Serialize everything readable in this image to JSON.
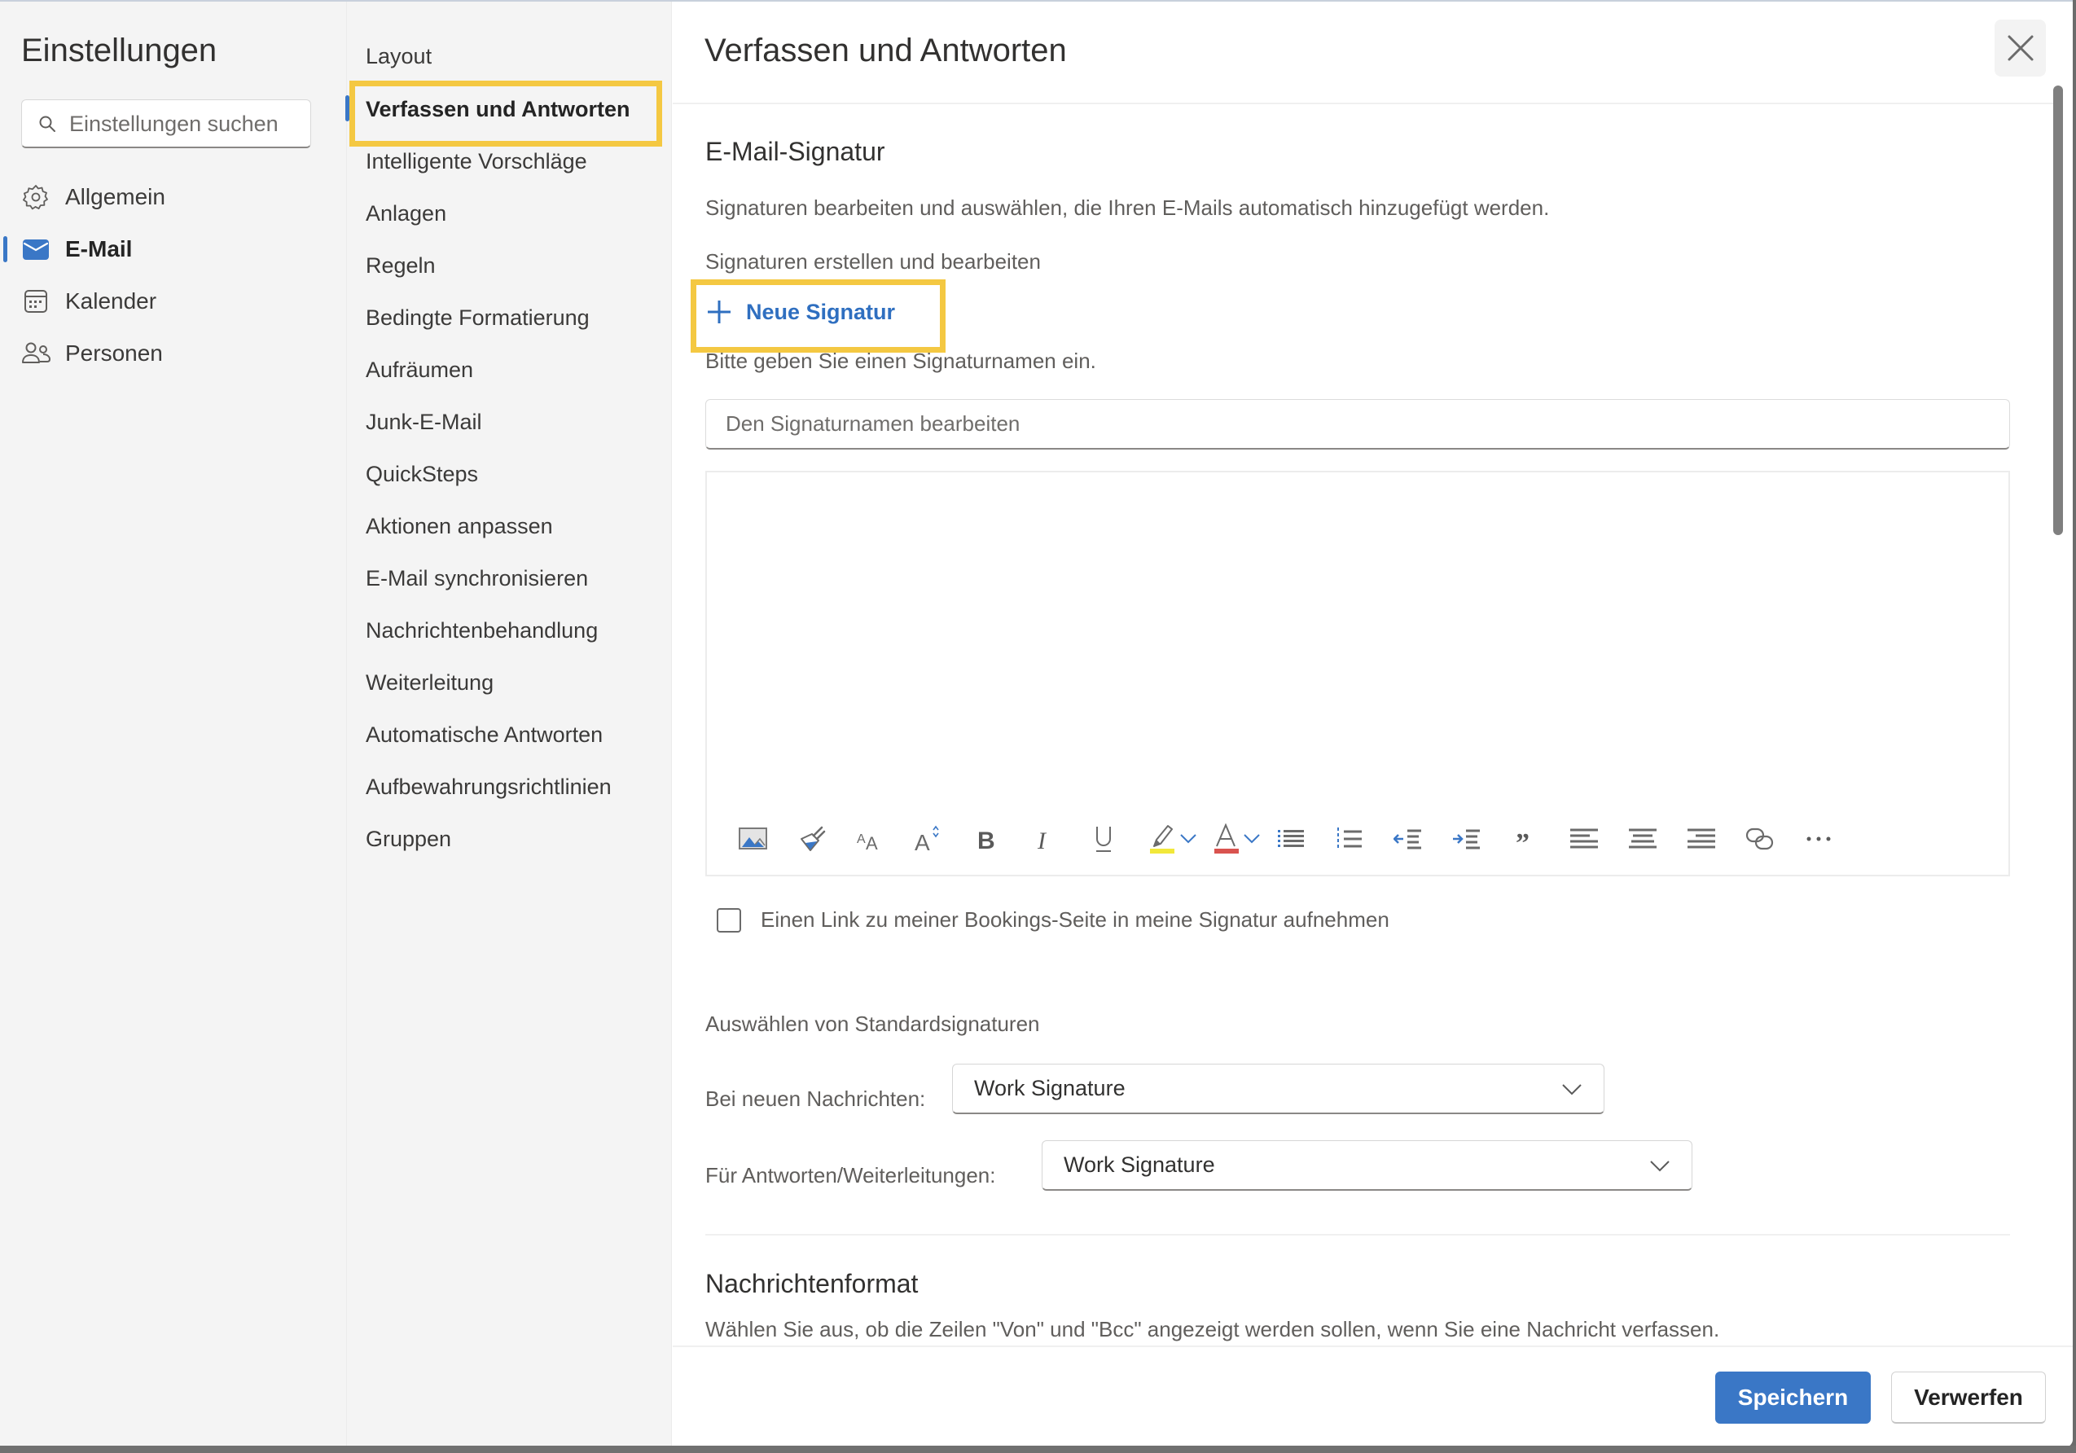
{
  "app": {
    "title": "Einstellungen",
    "search_placeholder": "Einstellungen suchen"
  },
  "nav": {
    "items": [
      {
        "label": "Allgemein",
        "icon": "gear-icon",
        "active": false
      },
      {
        "label": "E-Mail",
        "icon": "mail-icon",
        "active": true
      },
      {
        "label": "Kalender",
        "icon": "calendar-icon",
        "active": false
      },
      {
        "label": "Personen",
        "icon": "people-icon",
        "active": false
      }
    ]
  },
  "subnav": {
    "items": [
      {
        "label": "Layout",
        "active": false
      },
      {
        "label": "Verfassen und Antworten",
        "active": true
      },
      {
        "label": "Intelligente Vorschläge",
        "active": false
      },
      {
        "label": "Anlagen",
        "active": false
      },
      {
        "label": "Regeln",
        "active": false
      },
      {
        "label": "Bedingte Formatierung",
        "active": false
      },
      {
        "label": "Aufräumen",
        "active": false
      },
      {
        "label": "Junk-E-Mail",
        "active": false
      },
      {
        "label": "QuickSteps",
        "active": false
      },
      {
        "label": "Aktionen anpassen",
        "active": false
      },
      {
        "label": "E-Mail synchronisieren",
        "active": false
      },
      {
        "label": "Nachrichtenbehandlung",
        "active": false
      },
      {
        "label": "Weiterleitung",
        "active": false
      },
      {
        "label": "Automatische Antworten",
        "active": false
      },
      {
        "label": "Aufbewahrungsrichtlinien",
        "active": false
      },
      {
        "label": "Gruppen",
        "active": false
      }
    ]
  },
  "main": {
    "title": "Verfassen und Antworten",
    "close_icon": "close-icon",
    "signature": {
      "heading": "E-Mail-Signatur",
      "description": "Signaturen bearbeiten und auswählen, die Ihren E-Mails automatisch hinzugefügt werden.",
      "create_label": "Signaturen erstellen und bearbeiten",
      "new_signature_label": "Neue Signatur",
      "name_prompt": "Bitte geben Sie einen Signaturnamen ein.",
      "name_input_value": "",
      "name_input_placeholder": "Den Signaturnamen bearbeiten",
      "editor_content": "",
      "toolbar": [
        {
          "name": "insert-image",
          "icon": "image-icon"
        },
        {
          "name": "format-painter",
          "icon": "paintbrush-icon"
        },
        {
          "name": "font-size",
          "icon": "font-size-icon"
        },
        {
          "name": "text-effects",
          "icon": "text-effects-icon"
        },
        {
          "name": "bold",
          "icon": "bold-icon"
        },
        {
          "name": "italic",
          "icon": "italic-icon"
        },
        {
          "name": "underline",
          "icon": "underline-icon"
        },
        {
          "name": "highlight",
          "icon": "highlighter-icon",
          "color": "#f2e83a"
        },
        {
          "name": "highlight-dropdown",
          "icon": "chevron-down-icon"
        },
        {
          "name": "font-color",
          "icon": "font-color-icon",
          "color": "#d9534f"
        },
        {
          "name": "font-color-dropdown",
          "icon": "chevron-down-icon"
        },
        {
          "name": "bullets",
          "icon": "bulleted-list-icon"
        },
        {
          "name": "numbering",
          "icon": "numbered-list-icon"
        },
        {
          "name": "decrease-indent",
          "icon": "outdent-icon"
        },
        {
          "name": "increase-indent",
          "icon": "indent-icon"
        },
        {
          "name": "quote",
          "icon": "quote-icon"
        },
        {
          "name": "align-left",
          "icon": "align-left-icon"
        },
        {
          "name": "align-center",
          "icon": "align-center-icon"
        },
        {
          "name": "align-right",
          "icon": "align-right-icon"
        },
        {
          "name": "link",
          "icon": "link-icon"
        },
        {
          "name": "more",
          "icon": "more-icon"
        }
      ],
      "bookings_checkbox_label": "Einen Link zu meiner Bookings-Seite in meine Signatur aufnehmen",
      "bookings_checked": false
    },
    "defaults": {
      "heading": "Auswählen von Standardsignaturen",
      "new_messages_label": "Bei neuen Nachrichten:",
      "new_messages_value": "Work Signature",
      "replies_label": "Für Antworten/Weiterleitungen:",
      "replies_value": "Work Signature"
    },
    "message_format": {
      "heading": "Nachrichtenformat",
      "description": "Wählen Sie aus, ob die Zeilen \"Von\" und \"Bcc\" angezeigt werden sollen, wenn Sie eine Nachricht verfassen."
    }
  },
  "footer": {
    "save_label": "Speichern",
    "discard_label": "Verwerfen"
  },
  "colors": {
    "accent": "#3a77c6",
    "highlight_box": "#f4c842",
    "sidebar_bg": "#f4f4f4"
  }
}
